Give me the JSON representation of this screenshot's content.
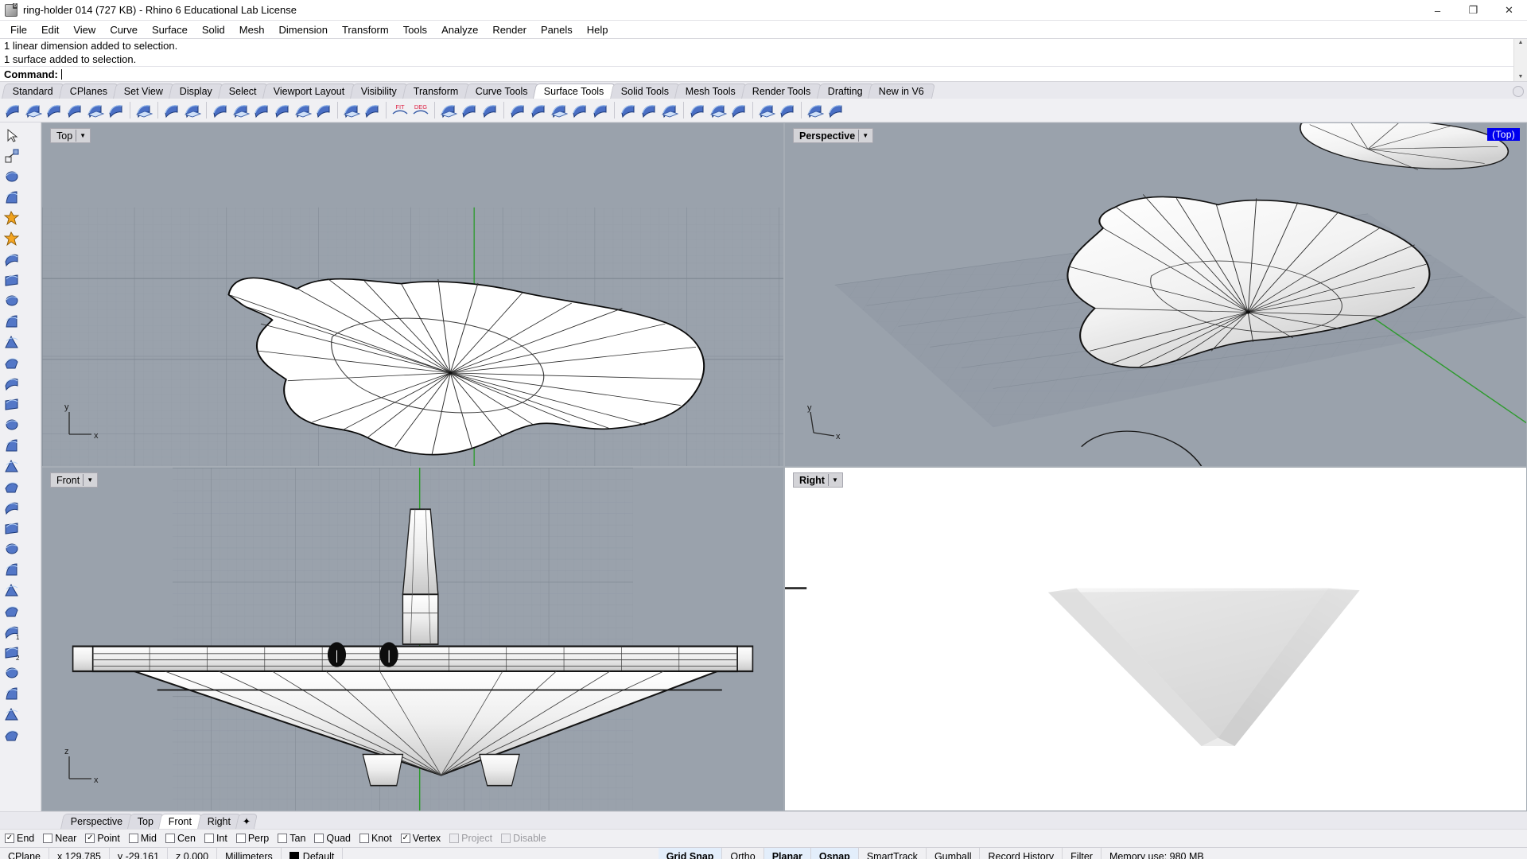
{
  "window": {
    "title": "ring-holder 014 (727 KB) - Rhino 6 Educational Lab License",
    "minimize": "–",
    "maximize": "❐",
    "close": "✕"
  },
  "menu": {
    "items": [
      "File",
      "Edit",
      "View",
      "Curve",
      "Surface",
      "Solid",
      "Mesh",
      "Dimension",
      "Transform",
      "Tools",
      "Analyze",
      "Render",
      "Panels",
      "Help"
    ]
  },
  "command": {
    "history": [
      "1 linear dimension added to selection.",
      "1 surface added to selection."
    ],
    "prompt_label": "Command:",
    "prompt_value": "",
    "scroll_up": "▲",
    "scroll_down": "▼"
  },
  "toolbar_tabs": {
    "items": [
      {
        "label": "Standard",
        "active": false
      },
      {
        "label": "CPlanes",
        "active": false
      },
      {
        "label": "Set View",
        "active": false
      },
      {
        "label": "Display",
        "active": false
      },
      {
        "label": "Select",
        "active": false
      },
      {
        "label": "Viewport Layout",
        "active": false
      },
      {
        "label": "Visibility",
        "active": false
      },
      {
        "label": "Transform",
        "active": false
      },
      {
        "label": "Curve Tools",
        "active": false
      },
      {
        "label": "Surface Tools",
        "active": true
      },
      {
        "label": "Solid Tools",
        "active": false
      },
      {
        "label": "Mesh Tools",
        "active": false
      },
      {
        "label": "Render Tools",
        "active": false
      },
      {
        "label": "Drafting",
        "active": false
      },
      {
        "label": "New in V6",
        "active": false
      }
    ]
  },
  "icon_toolbar": {
    "buttons": [
      {
        "name": "surface-from-edge-curves-icon",
        "glyph": "surf1"
      },
      {
        "name": "surface-from-planar-curves-icon",
        "glyph": "surf2"
      },
      {
        "name": "surface-from-network-icon",
        "glyph": "surf3"
      },
      {
        "name": "extrude-surface-tapered-icon",
        "glyph": "surf4"
      },
      {
        "name": "extrude-surface-icon",
        "glyph": "surf5"
      },
      {
        "name": "sweep-1-rail-icon",
        "glyph": "surf6"
      },
      {
        "sep": true
      },
      {
        "name": "offset-curve-on-surface-icon",
        "glyph": "curve1"
      },
      {
        "sep": true
      },
      {
        "name": "blend-surface-icon",
        "glyph": "blend1"
      },
      {
        "name": "match-surface-icon",
        "glyph": "blend2"
      },
      {
        "sep": true
      },
      {
        "name": "fillet-surface-icon",
        "glyph": "fil1"
      },
      {
        "name": "chamfer-surface-icon",
        "glyph": "fil2"
      },
      {
        "name": "variable-fillet-icon",
        "glyph": "fil3"
      },
      {
        "name": "offset-surface-icon",
        "glyph": "fil4"
      },
      {
        "name": "revolve-icon",
        "glyph": "fil5"
      },
      {
        "name": "loft-icon",
        "glyph": "fil6"
      },
      {
        "sep": true
      },
      {
        "name": "rebuild-surface-icon",
        "glyph": "rb1"
      },
      {
        "name": "change-degree-icon",
        "glyph": "rb2"
      },
      {
        "sep": true
      },
      {
        "name": "fit-surface-icon",
        "glyph": "text-FIT",
        "text": "FIT"
      },
      {
        "name": "degree-icon",
        "glyph": "text-DEG",
        "text": "DEG"
      },
      {
        "sep": true
      },
      {
        "name": "untrim-icon",
        "glyph": "ut1"
      },
      {
        "name": "split-surface-icon",
        "glyph": "ut2"
      },
      {
        "name": "shrink-trimmed-surface-icon",
        "glyph": "ut3"
      },
      {
        "sep": true
      },
      {
        "name": "surface-from-points-icon",
        "glyph": "pt1"
      },
      {
        "name": "patch-icon",
        "glyph": "pt2"
      },
      {
        "name": "drape-icon",
        "glyph": "pt3"
      },
      {
        "name": "heightfield-icon",
        "glyph": "pt4"
      },
      {
        "name": "unroll-surface-icon",
        "glyph": "pt5"
      },
      {
        "sep": true
      },
      {
        "name": "symmetry-icon",
        "glyph": "sy1"
      },
      {
        "name": "mirror-surface-icon",
        "glyph": "sy2"
      },
      {
        "name": "smash-icon",
        "glyph": "sy3"
      },
      {
        "sep": true
      },
      {
        "name": "surface-seam-icon",
        "glyph": "se1"
      },
      {
        "name": "merge-surface-icon",
        "glyph": "se2"
      },
      {
        "name": "join-surface-icon",
        "glyph": "se3"
      },
      {
        "sep": true
      },
      {
        "name": "render-color-icon",
        "glyph": "rc1"
      },
      {
        "name": "apply-texture-icon",
        "glyph": "rc2"
      },
      {
        "sep": true
      },
      {
        "name": "dimension-linear-icon",
        "glyph": "dm1"
      },
      {
        "name": "dimension-aligned-icon",
        "glyph": "dm2"
      }
    ]
  },
  "side_toolbar": {
    "buttons": [
      {
        "name": "select-arrow-icon"
      },
      {
        "name": "select-window-icon"
      },
      {
        "name": "extrude-surface-straight-icon"
      },
      {
        "name": "extrude-surface-along-curve-icon"
      },
      {
        "name": "boolean-union-icon"
      },
      {
        "name": "explode-icon"
      },
      {
        "name": "control-point-surface-icon"
      },
      {
        "name": "surface-from-curve-network-icon"
      },
      {
        "name": "circle-surface-icon"
      },
      {
        "name": "sweep-fan-icon"
      },
      {
        "name": "blend-surface-curve-icon"
      },
      {
        "name": "patch-surface-icon"
      },
      {
        "name": "rectangular-plane-icon"
      },
      {
        "name": "plane-3point-icon"
      },
      {
        "name": "loft-surface-icon"
      },
      {
        "name": "surface-from-points-grid-icon"
      },
      {
        "name": "mirror-plane-icon"
      },
      {
        "name": "heightfield-from-image-icon"
      },
      {
        "name": "cylinder-surface-icon"
      },
      {
        "name": "revolve-surface-icon"
      },
      {
        "name": "dome-surface-icon"
      },
      {
        "name": "cone-surface-icon"
      },
      {
        "name": "curve-to-surface-icon"
      },
      {
        "name": "sphere-section-icon"
      },
      {
        "name": "fillet-surface-1-icon",
        "badge": "1"
      },
      {
        "name": "fillet-surface-2-icon",
        "badge": "2"
      },
      {
        "name": "drape-surface-icon"
      },
      {
        "name": "squish-surface-icon"
      },
      {
        "name": "blur-surface-icon"
      },
      {
        "name": "control-point-grid-icon"
      }
    ]
  },
  "viewports": [
    {
      "name": "top",
      "label": "Top",
      "style": "shaded-wire",
      "badge": null,
      "axis": {
        "v": "y",
        "h": "x"
      }
    },
    {
      "name": "perspective",
      "label": "Perspective",
      "style": "shaded",
      "badge": "(Top)",
      "axis": {
        "v": "y",
        "h": "x"
      }
    },
    {
      "name": "front",
      "label": "Front",
      "style": "shaded-wire",
      "badge": null,
      "axis": {
        "v": "z",
        "h": "x"
      }
    },
    {
      "name": "right",
      "label": "Right",
      "style": "shaded-white",
      "badge": null,
      "axis": null
    }
  ],
  "viewport_tabs": {
    "items": [
      {
        "label": "Perspective",
        "active": false
      },
      {
        "label": "Top",
        "active": false
      },
      {
        "label": "Front",
        "active": true
      },
      {
        "label": "Right",
        "active": false
      }
    ],
    "add_label": "✦"
  },
  "osnap": {
    "items": [
      {
        "label": "End",
        "checked": true,
        "disabled": false
      },
      {
        "label": "Near",
        "checked": false,
        "disabled": false
      },
      {
        "label": "Point",
        "checked": true,
        "disabled": false
      },
      {
        "label": "Mid",
        "checked": false,
        "disabled": false
      },
      {
        "label": "Cen",
        "checked": false,
        "disabled": false
      },
      {
        "label": "Int",
        "checked": false,
        "disabled": false
      },
      {
        "label": "Perp",
        "checked": false,
        "disabled": false
      },
      {
        "label": "Tan",
        "checked": false,
        "disabled": false
      },
      {
        "label": "Quad",
        "checked": false,
        "disabled": false
      },
      {
        "label": "Knot",
        "checked": false,
        "disabled": false
      },
      {
        "label": "Vertex",
        "checked": true,
        "disabled": false
      },
      {
        "label": "Project",
        "checked": false,
        "disabled": true
      },
      {
        "label": "Disable",
        "checked": false,
        "disabled": true
      }
    ],
    "check_glyph": "✓"
  },
  "statusbar": {
    "cplane": "CPlane",
    "x": "x 129.785",
    "y": "y -29.161",
    "z": "z 0.000",
    "units": "Millimeters",
    "layer": "Default",
    "layer_color": "#000000",
    "toggles": [
      {
        "label": "Grid Snap",
        "on": true
      },
      {
        "label": "Ortho",
        "on": false
      },
      {
        "label": "Planar",
        "on": true
      },
      {
        "label": "Osnap",
        "on": true
      },
      {
        "label": "SmartTrack",
        "on": false
      },
      {
        "label": "Gumball",
        "on": false
      },
      {
        "label": "Record History",
        "on": false
      },
      {
        "label": "Filter",
        "on": false
      }
    ],
    "memory": "Memory use: 980 MB"
  },
  "colors": {
    "viewport_bg": "#9aa2ac",
    "viewport_white": "#ffffff",
    "chrome": "#f0f0f3",
    "accent_blue": "#0000ee",
    "axis_green": "#2e9b2e",
    "axis_red": "#b03030",
    "toggle_on_bg": "#e3eefb"
  }
}
